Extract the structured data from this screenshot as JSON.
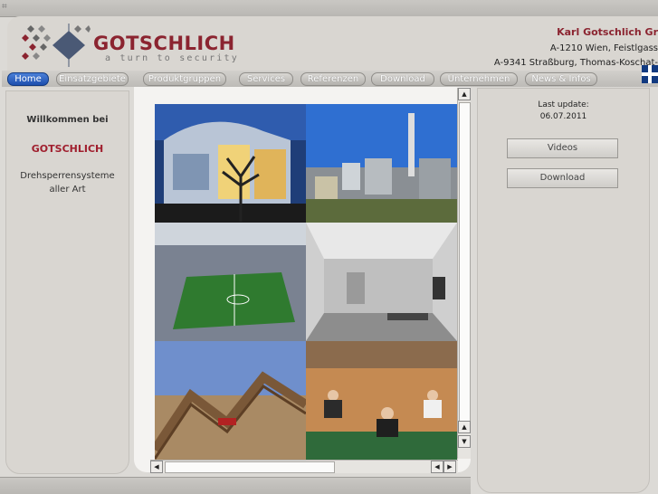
{
  "brand": {
    "name": "GOTSCHLICH",
    "slogan": "a turn to security"
  },
  "company": {
    "name": "Karl Gotschlich Gr",
    "address1": "A-1210 Wien, Feistlgass",
    "address2": "A-9341 Straßburg, Thomas-Koschat-"
  },
  "nav": [
    {
      "label": "Home",
      "active": true
    },
    {
      "label": "Einsatzgebiete"
    },
    {
      "label": "Produktgruppen"
    },
    {
      "label": "Services"
    },
    {
      "label": "Referenzen"
    },
    {
      "label": "Download"
    },
    {
      "label": "Unternehmen"
    },
    {
      "label": "News & Infos"
    }
  ],
  "left": {
    "welcome": "Willkommen bei",
    "brand": "GOTSCHLICH",
    "desc": "Drehsperrensysteme aller Art"
  },
  "right": {
    "last_update_label": "Last update:",
    "last_update_date": "06.07.2011",
    "videos": "Videos",
    "download": "Download"
  },
  "gallery": [
    {
      "name": "photo-modern-building-night"
    },
    {
      "name": "photo-industrial-plant"
    },
    {
      "name": "photo-football-stadium"
    },
    {
      "name": "photo-gallery-room"
    },
    {
      "name": "photo-roller-coaster"
    },
    {
      "name": "photo-fitness-class"
    }
  ]
}
